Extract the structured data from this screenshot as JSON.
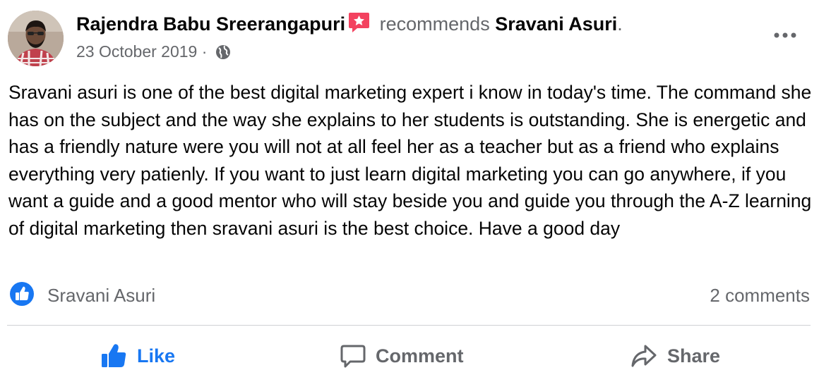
{
  "post": {
    "author": "Rajendra Babu Sreerangapuri",
    "badge_icon": "recommend-star-icon",
    "verb": "recommends",
    "target": "Sravani Asuri",
    "end_punct": ".",
    "date": "23 October 2019",
    "separator": "·",
    "audience_icon": "globe-icon",
    "more_icon": "more-options-icon",
    "text": "Sravani asuri is one of the best digital marketing expert i know in today's time. The command she has on the subject and the way she explains to her students is outstanding. She is energetic and has a friendly nature were you will not at all feel her as a teacher but as a friend who explains everything very patienly. If you want to just learn digital marketing you can go anywhere, if you want a guide and a good mentor who will stay beside you and guide you through the A-Z learning of digital marketing then sravani asuri is the best choice. Have a good day"
  },
  "reactions": {
    "icon": "like-reaction-icon",
    "name": "Sravani Asuri",
    "comments": "2 comments"
  },
  "actions": {
    "like": "Like",
    "comment": "Comment",
    "share": "Share"
  },
  "colors": {
    "accent": "#1877f2",
    "secondary_text": "#65676b",
    "badge": "#f3425f"
  }
}
